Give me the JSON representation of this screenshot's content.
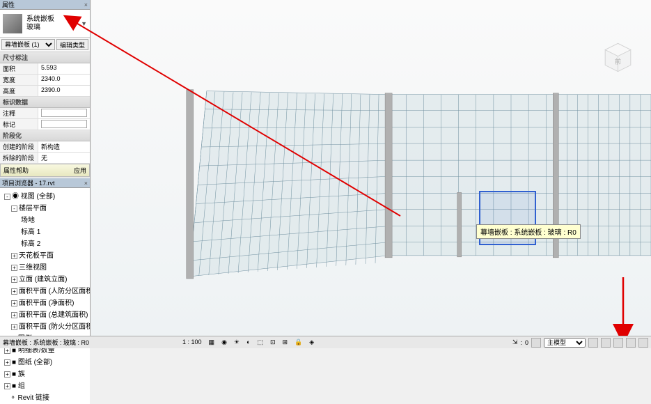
{
  "properties_panel": {
    "title": "属性",
    "family": {
      "name": "系统嵌板",
      "type": "玻璃"
    },
    "type_selector": {
      "value": "幕墙嵌板 (1)",
      "edit_btn": "编辑类型"
    },
    "categories": [
      {
        "header": "尺寸标注",
        "rows": [
          {
            "label": "面积",
            "value": "5.593"
          },
          {
            "label": "宽度",
            "value": "2340.0"
          },
          {
            "label": "高度",
            "value": "2390.0"
          }
        ]
      },
      {
        "header": "标识数据",
        "rows": [
          {
            "label": "注释",
            "value": ""
          },
          {
            "label": "标记",
            "value": ""
          }
        ]
      },
      {
        "header": "阶段化",
        "rows": [
          {
            "label": "创建的阶段",
            "value": "新构造"
          },
          {
            "label": "拆除的阶段",
            "value": "无"
          }
        ]
      }
    ],
    "help": {
      "label": "属性帮助",
      "apply": "应用"
    }
  },
  "browser": {
    "title": "项目浏览器 - 17.rvt",
    "root": "视图 (全部)",
    "groups": [
      {
        "label": "楼层平面",
        "exp": "-",
        "children": [
          "场地",
          "标高 1",
          "标高 2"
        ]
      },
      {
        "label": "天花板平面",
        "exp": "+"
      },
      {
        "label": "三维视图",
        "exp": "+"
      },
      {
        "label": "立面 (建筑立面)",
        "exp": "+"
      },
      {
        "label": "面积平面 (人防分区面积)",
        "exp": "+"
      },
      {
        "label": "面积平面 (净面积)",
        "exp": "+"
      },
      {
        "label": "面积平面 (总建筑面积)",
        "exp": "+"
      },
      {
        "label": "面积平面 (防火分区面积)",
        "exp": "+"
      }
    ],
    "others": [
      "图例",
      "明细表/数量",
      "图纸 (全部)",
      "族",
      "组",
      "Revit 链接"
    ]
  },
  "viewport": {
    "tooltip": "幕墙嵌板 : 系统嵌板 : 玻璃 : R0",
    "viewcube_label": "前"
  },
  "status": {
    "left_text": "幕墙嵌板 : 系统嵌板 : 玻璃 : R0",
    "scale": "1 : 100",
    "model_label": "主模型",
    "push_val": "0"
  }
}
